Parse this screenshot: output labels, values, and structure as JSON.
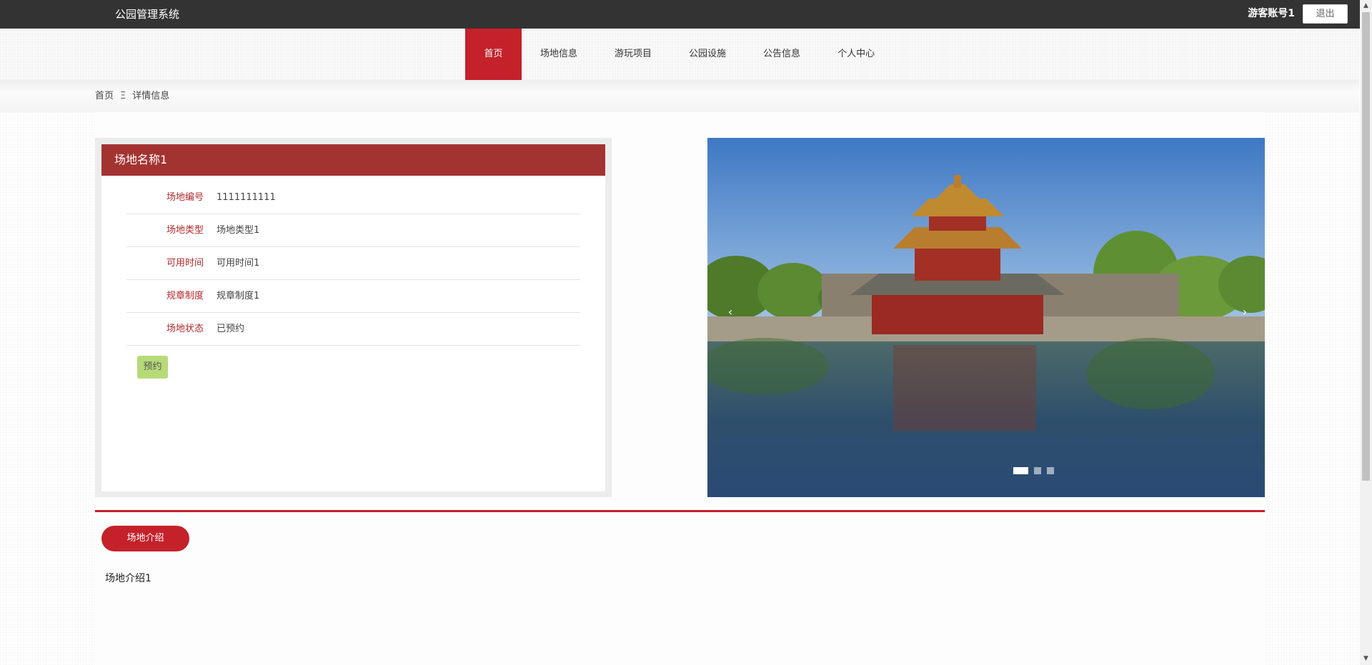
{
  "header": {
    "app_title": "公园管理系统",
    "user_name": "游客账号1",
    "logout_label": "退出"
  },
  "nav": {
    "items": [
      {
        "label": "首页",
        "active": true
      },
      {
        "label": "场地信息"
      },
      {
        "label": "游玩项目"
      },
      {
        "label": "公园设施"
      },
      {
        "label": "公告信息"
      },
      {
        "label": "个人中心"
      }
    ]
  },
  "breadcrumb": {
    "home": "首页",
    "separator": "Ξ",
    "current": "详情信息"
  },
  "detail": {
    "title": "场地名称1",
    "fields": [
      {
        "label": "场地编号",
        "value": "1111111111"
      },
      {
        "label": "场地类型",
        "value": "场地类型1"
      },
      {
        "label": "可用时间",
        "value": "可用时间1"
      },
      {
        "label": "规章制度",
        "value": "规章制度1"
      },
      {
        "label": "场地状态",
        "value": "已预约"
      }
    ],
    "book_label": "预约"
  },
  "carousel": {
    "prev_glyph": "‹",
    "next_glyph": "›",
    "slide_count": 3,
    "active_index": 0
  },
  "intro": {
    "tab_label": "场地介绍",
    "text": "场地介绍1"
  },
  "colors": {
    "topbar": "#333333",
    "accent_red": "#c4212b",
    "panel_header": "#a33331",
    "book_button": "#b7da79"
  }
}
